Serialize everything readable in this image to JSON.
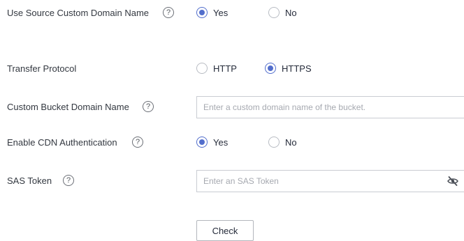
{
  "form": {
    "source_domain": {
      "label": "Use Source Custom Domain Name",
      "help": "?",
      "options": [
        {
          "label": "Yes",
          "checked": true
        },
        {
          "label": "No",
          "checked": false
        }
      ]
    },
    "transfer_protocol": {
      "label": "Transfer Protocol",
      "options": [
        {
          "label": "HTTP",
          "checked": false
        },
        {
          "label": "HTTPS",
          "checked": true
        }
      ]
    },
    "bucket_domain": {
      "label": "Custom Bucket Domain Name",
      "help": "?",
      "placeholder": "Enter a custom domain name of the bucket.",
      "value": ""
    },
    "cdn_auth": {
      "label": "Enable CDN Authentication",
      "help": "?",
      "options": [
        {
          "label": "Yes",
          "checked": true
        },
        {
          "label": "No",
          "checked": false
        }
      ]
    },
    "sas_token": {
      "label": "SAS Token",
      "help": "?",
      "placeholder": "Enter an SAS Token",
      "value": "",
      "toggle_icon": "eye-slash-icon"
    },
    "check_label": "Check"
  },
  "colors": {
    "accent": "#526ecc",
    "text": "#333840",
    "placeholder": "#a6a9b0",
    "border": "#c9ccd2"
  }
}
